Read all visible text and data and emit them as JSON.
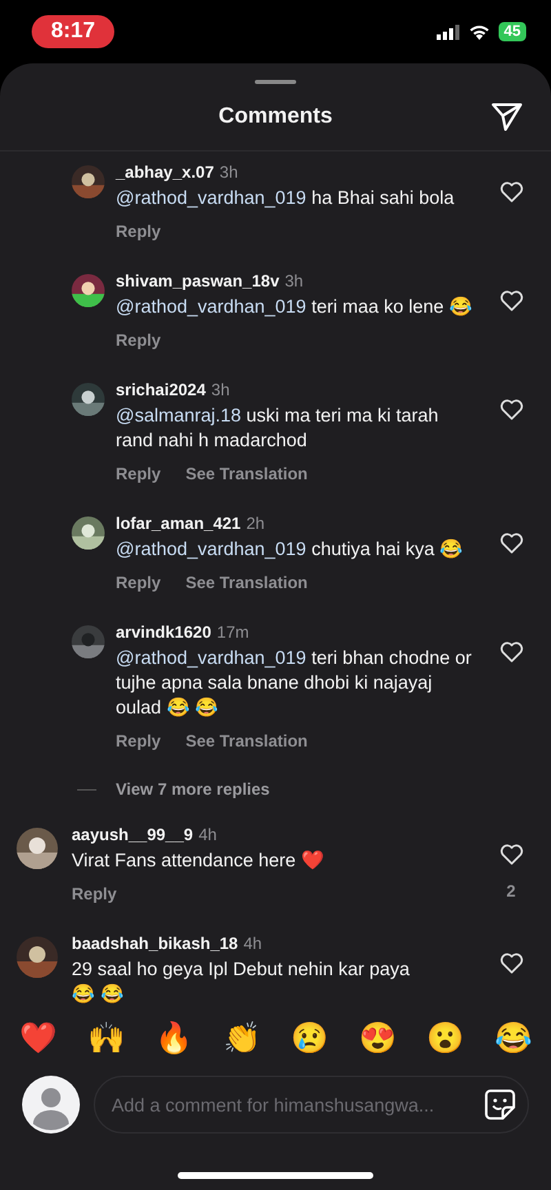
{
  "status_bar": {
    "time": "8:17",
    "battery": "45"
  },
  "sheet": {
    "title": "Comments"
  },
  "comments": [
    {
      "kind": "reply",
      "username": "_abhay_x.07",
      "time": "3h",
      "mention": "@rathod_vardhan_019",
      "text": "ha Bhai sahi bola",
      "actions": [
        "Reply"
      ]
    },
    {
      "kind": "reply",
      "username": "shivam_paswan_18v",
      "time": "3h",
      "mention": "@rathod_vardhan_019",
      "text": "teri maa ko lene 😂",
      "actions": [
        "Reply"
      ]
    },
    {
      "kind": "reply",
      "username": "srichai2024",
      "time": "3h",
      "mention": "@salmanraj.18",
      "text": "uski ma teri ma ki tarah rand nahi h madarchod",
      "actions": [
        "Reply",
        "See Translation"
      ]
    },
    {
      "kind": "reply",
      "username": "lofar_aman_421",
      "time": "2h",
      "mention": "@rathod_vardhan_019",
      "text": "chutiya hai kya 😂",
      "actions": [
        "Reply",
        "See Translation"
      ]
    },
    {
      "kind": "reply",
      "username": "arvindk1620",
      "time": "17m",
      "mention": "@rathod_vardhan_019",
      "text": "teri bhan chodne or tujhe apna sala bnane dhobi ki najayaj oulad 😂 😂",
      "actions": [
        "Reply",
        "See Translation"
      ]
    },
    {
      "kind": "more",
      "label": "View 7 more replies"
    },
    {
      "kind": "comment",
      "username": "aayush__99__9",
      "time": "4h",
      "text": "Virat Fans attendance here ❤️",
      "actions": [
        "Reply"
      ],
      "likes": "2"
    },
    {
      "kind": "comment",
      "username": "baadshah_bikash_18",
      "time": "4h",
      "text": "29 saal ho geya Ipl Debut nehin kar paya 😂 😂"
    }
  ],
  "reactions": [
    "❤️",
    "🙌",
    "🔥",
    "👏",
    "😢",
    "😍",
    "😮",
    "😂"
  ],
  "composer": {
    "placeholder": "Add a comment for himanshusangwa..."
  }
}
